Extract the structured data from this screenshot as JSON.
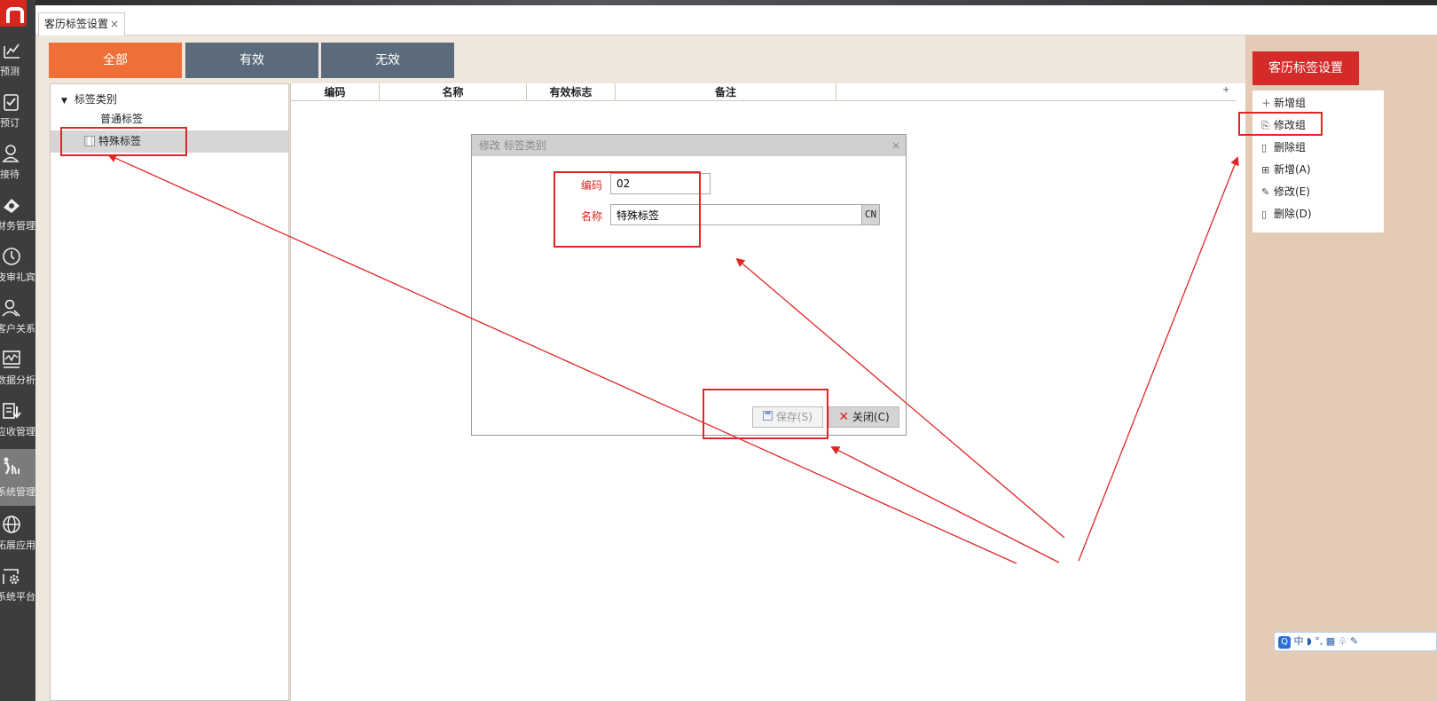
{
  "rail": {
    "items": [
      {
        "label": "预测",
        "icon": "chart-icon"
      },
      {
        "label": "预订",
        "icon": "clipboard-check-icon"
      },
      {
        "label": "接待",
        "icon": "person-icon"
      },
      {
        "label": "财务管理",
        "icon": "money-icon"
      },
      {
        "label": "夜审礼宾",
        "icon": "clock-icon"
      },
      {
        "label": "客户关系",
        "icon": "people-icon"
      },
      {
        "label": "数据分析",
        "icon": "analysis-icon"
      },
      {
        "label": "应收管理",
        "icon": "receivable-icon"
      },
      {
        "label": "系统管理",
        "icon": "admin-icon"
      },
      {
        "label": "拓展应用",
        "icon": "globe-icon"
      },
      {
        "label": "系统平台",
        "icon": "settings-icon"
      }
    ]
  },
  "tabs": [
    {
      "label": "客历标签设置",
      "close": "×"
    }
  ],
  "filters": [
    {
      "label": "全部",
      "active": true
    },
    {
      "label": "有效",
      "active": false
    },
    {
      "label": "无效",
      "active": false
    }
  ],
  "tree": {
    "root": "标签类别",
    "caret": "▼",
    "nodes": [
      {
        "label": "普通标签",
        "selected": false
      },
      {
        "label": "特殊标签",
        "selected": true
      }
    ]
  },
  "grid": {
    "columns": [
      "编码",
      "名称",
      "有效标志",
      "备注",
      ""
    ],
    "plus": "+"
  },
  "dialog": {
    "title": "修改 标签类别",
    "close": "×",
    "code_label": "编码",
    "code_value": "02",
    "name_label": "名称",
    "name_value": "特殊标签",
    "cn": "CN",
    "save": "保存(S)",
    "cancel": "关闭(C)"
  },
  "right_panel": {
    "title": "客历标签设置",
    "menu": [
      {
        "label": "新增组",
        "icon": "plus-icon"
      },
      {
        "label": "修改组",
        "icon": "edit-group-icon"
      },
      {
        "label": "删除组",
        "icon": "trash-icon"
      },
      {
        "label": "新增(A)",
        "icon": "add-box-icon"
      },
      {
        "label": "修改(E)",
        "icon": "pencil-icon"
      },
      {
        "label": "删除(D)",
        "icon": "trash-icon"
      }
    ]
  },
  "ime": {
    "text": "中 ◗ °, ▦ ♧ ✎",
    "q": "Q"
  },
  "colors": {
    "accent_orange": "#ef6f38",
    "filter_gray": "#5c6b7b",
    "header_red": "#d32a2a",
    "annotation_red": "#e12626",
    "label_red": "#d7261e"
  }
}
